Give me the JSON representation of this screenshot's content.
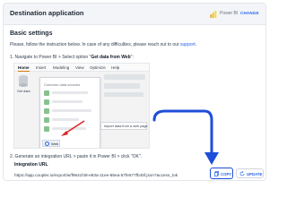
{
  "header": {
    "title": "Destination application",
    "app_name": "Power BI",
    "change_label": "CHANGE"
  },
  "section": {
    "title": "Basic settings",
    "intro_text": "Please, follow the instruction below. In case of any difficulties, please reach out to our ",
    "support_link": "support",
    "intro_end": "."
  },
  "step1": {
    "prefix": "1. Navigate to Power BI > Select option \"",
    "bold": "Get data from Web",
    "suffix": "\":"
  },
  "screenshot": {
    "ribbon_tabs": [
      "Home",
      "Insert",
      "Modeling",
      "View",
      "Optimize",
      "Help"
    ],
    "get_data_label": "Get data",
    "dropdown_title": "Common data sources",
    "web_label": "Web",
    "tooltip": "Import data from a web page."
  },
  "step2": {
    "text": "2. Generate an integration URL > paste it in Power BI > click \"OK\".",
    "integration_label": "Integration URL",
    "url": "https://app.coupler.io/export/w/f964cf48-e83a-11ee-85ea-57fe577fb45f.json?access_tok"
  },
  "buttons": {
    "copy": "COPY",
    "update": "UPDATE"
  },
  "colors": {
    "accent": "#2563eb",
    "highlight_arrow": "#1d4ed8",
    "screenshot_arrow": "#dc2626",
    "power_bi": "#f2c811"
  }
}
